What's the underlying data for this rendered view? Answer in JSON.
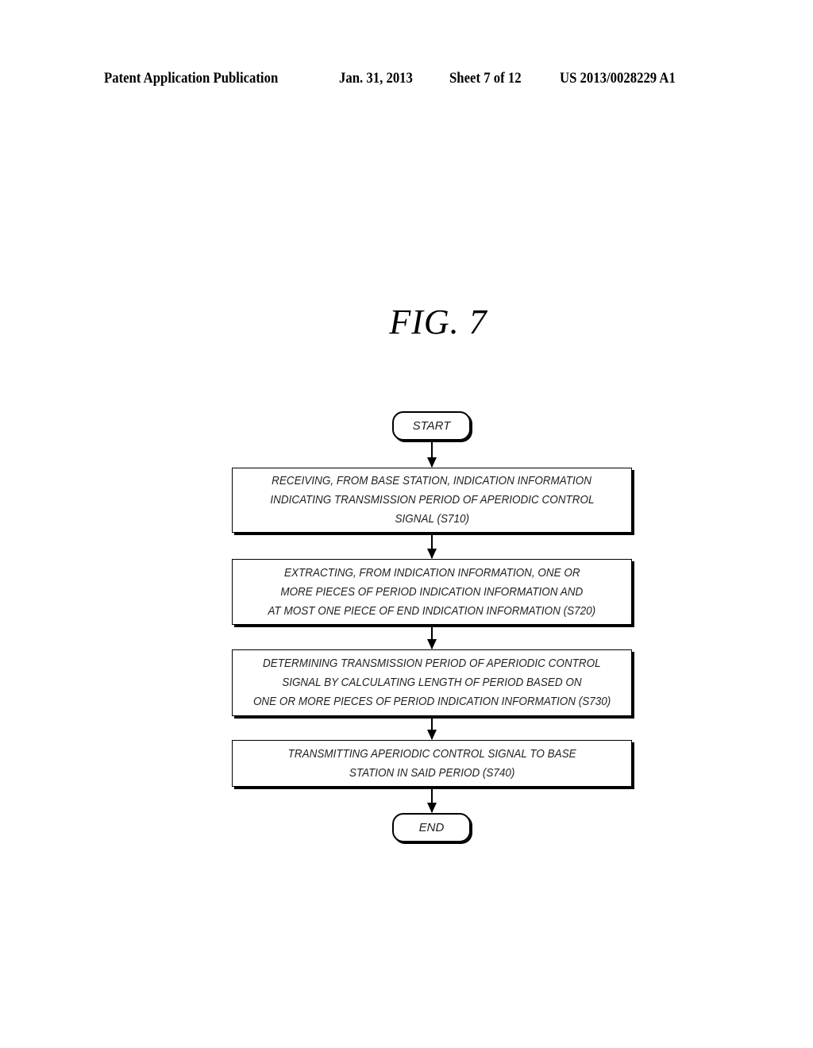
{
  "header": {
    "publication_type": "Patent Application Publication",
    "date": "Jan. 31, 2013",
    "sheet": "Sheet 7 of 12",
    "publication_number": "US 2013/0028229 A1"
  },
  "figure": {
    "title": "FIG. 7"
  },
  "flowchart": {
    "start": "START",
    "end": "END",
    "steps": [
      {
        "id": "S710",
        "lines": [
          "RECEIVING, FROM BASE STATION, INDICATION INFORMATION",
          "INDICATING TRANSMISSION PERIOD OF APERIODIC CONTROL",
          "SIGNAL (S710)"
        ]
      },
      {
        "id": "S720",
        "lines": [
          "EXTRACTING, FROM INDICATION INFORMATION, ONE OR",
          "MORE PIECES OF PERIOD INDICATION INFORMATION AND",
          "AT MOST ONE PIECE OF END INDICATION INFORMATION (S720)"
        ]
      },
      {
        "id": "S730",
        "lines": [
          "DETERMINING TRANSMISSION PERIOD OF APERIODIC CONTROL",
          "SIGNAL BY CALCULATING LENGTH OF PERIOD BASED ON",
          "ONE OR MORE PIECES OF PERIOD INDICATION INFORMATION (S730)"
        ]
      },
      {
        "id": "S740",
        "lines": [
          "TRANSMITTING APERIODIC CONTROL SIGNAL TO BASE",
          "STATION IN SAID PERIOD (S740)"
        ]
      }
    ]
  }
}
